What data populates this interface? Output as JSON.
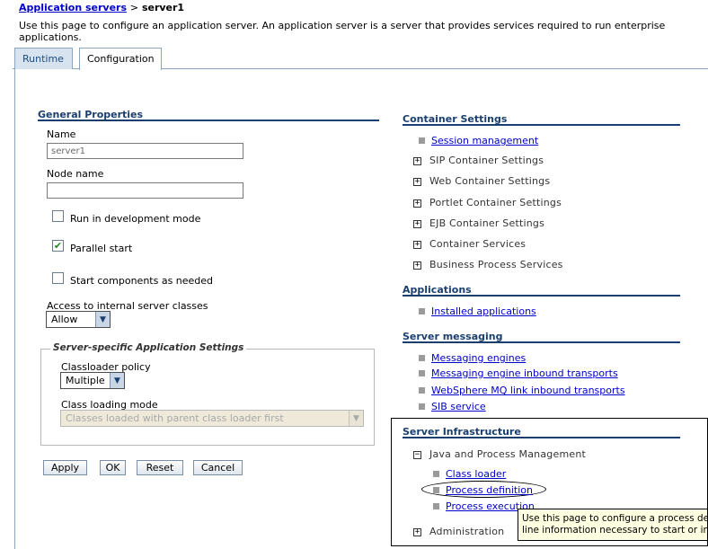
{
  "breadcrumb": {
    "parent": "Application servers",
    "separator": ">",
    "current": "server1"
  },
  "description": "Use this page to configure an application server. An application server is a server that provides services required to run enterprise applications.",
  "tabs": [
    {
      "label": "Runtime"
    },
    {
      "label": "Configuration"
    }
  ],
  "general": {
    "title": "General Properties",
    "name_label": "Name",
    "name_value": "server1",
    "node_label": "Node name",
    "node_value": "",
    "run_dev_label": "Run in development mode",
    "run_dev_checked": false,
    "parallel_label": "Parallel start",
    "parallel_checked": true,
    "start_components_label": "Start components as needed",
    "start_components_checked": false,
    "access_label": "Access to internal server classes",
    "access_value": "Allow"
  },
  "server_specific": {
    "legend": "Server-specific Application Settings",
    "classloader_policy_label": "Classloader policy",
    "classloader_policy_value": "Multiple",
    "class_loading_mode_label": "Class loading mode",
    "class_loading_mode_value": "Classes loaded with parent class loader first"
  },
  "buttons": {
    "apply": "Apply",
    "ok": "OK",
    "reset": "Reset",
    "cancel": "Cancel"
  },
  "container": {
    "title": "Container Settings",
    "session": "Session management",
    "items": [
      "SIP Container Settings",
      "Web Container Settings",
      "Portlet Container Settings",
      "EJB Container Settings",
      "Container Services",
      "Business Process Services"
    ]
  },
  "applications": {
    "title": "Applications",
    "installed": "Installed applications"
  },
  "messaging": {
    "title": "Server messaging",
    "links": [
      "Messaging engines",
      "Messaging engine inbound transports",
      "WebSphere MQ link inbound transports",
      "SIB service"
    ]
  },
  "infrastructure": {
    "title": "Server Infrastructure",
    "java_process": "Java and Process Management",
    "class_loader": "Class loader",
    "process_definition": "Process definition",
    "process_execution": "Process execution",
    "administration": "Administration"
  },
  "tooltip": {
    "line1": "Use this page to configure a process definit",
    "line2": "line information necessary to start or initiali"
  }
}
